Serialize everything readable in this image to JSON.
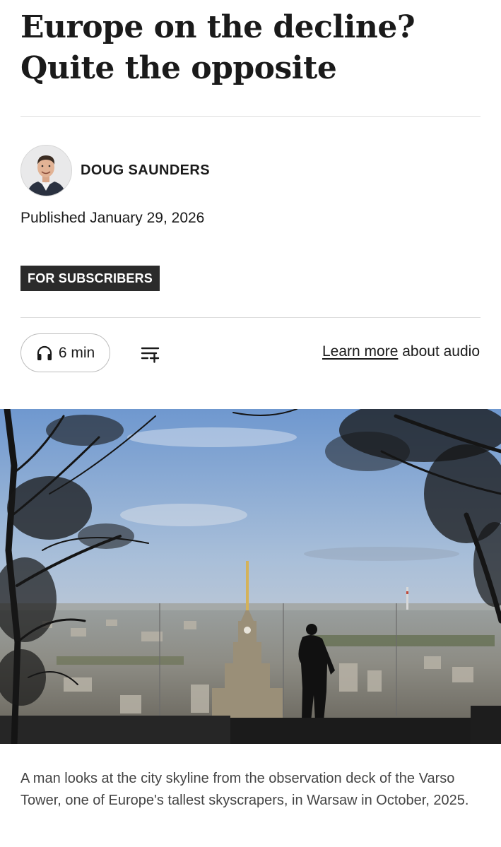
{
  "article": {
    "headline": "Europe on the decline? Quite the opposite",
    "author": "DOUG SAUNDERS",
    "published": "Published January 29, 2026",
    "badge": "FOR SUBSCRIBERS"
  },
  "audio": {
    "duration": "6 min",
    "learn_more_link": "Learn more",
    "learn_more_suffix": " about audio"
  },
  "photo": {
    "caption": "A man looks at the city skyline from the observation deck of the Varso Tower, one of Europe's tallest skyscrapers, in Warsaw in October, 2025."
  },
  "icons": {
    "headphones": "headphones-icon",
    "queue": "add-to-queue-icon"
  },
  "colors": {
    "badge_bg": "#2b2b2b",
    "rule": "#dcdcdc",
    "caption_text": "#444444"
  }
}
